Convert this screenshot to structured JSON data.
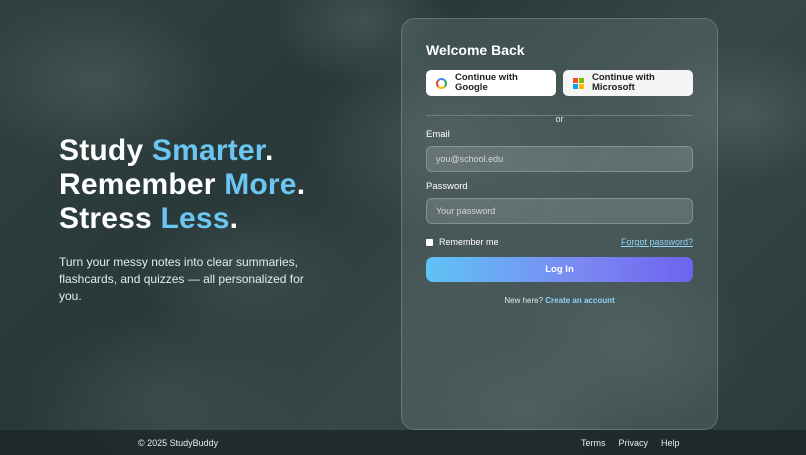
{
  "hero": {
    "line1_a": "Study ",
    "line1_b": "Smarter",
    "line1_c": ".",
    "line2_a": "Remember ",
    "line2_b": "More",
    "line2_c": ".",
    "line3_a": "Stress ",
    "line3_b": "Less",
    "line3_c": ".",
    "subtitle": "Turn your messy notes into clear summaries, flashcards, and quizzes — all personalized for you."
  },
  "login": {
    "title": "Welcome Back",
    "google_label": "Continue with Google",
    "microsoft_label": "Continue with Microsoft",
    "divider_text": "or",
    "email_label": "Email",
    "email_placeholder": "you@school.edu",
    "password_label": "Password",
    "password_placeholder": "Your password",
    "remember_label": "Remember me",
    "forgot_label": "Forgot password?",
    "login_button": "Log In",
    "signup_prompt": "New here?",
    "signup_link": "Create an account"
  },
  "footer": {
    "copyright": "© 2025 StudyBuddy",
    "links": [
      "Terms",
      "Privacy",
      "Help"
    ]
  },
  "colors": {
    "accent": "#6cc6f2",
    "button_gradient_start": "#5fc3f5",
    "button_gradient_end": "#6e63f0",
    "link": "#8fd3f7"
  },
  "icons": {
    "google": "google-icon",
    "microsoft": "microsoft-icon"
  }
}
